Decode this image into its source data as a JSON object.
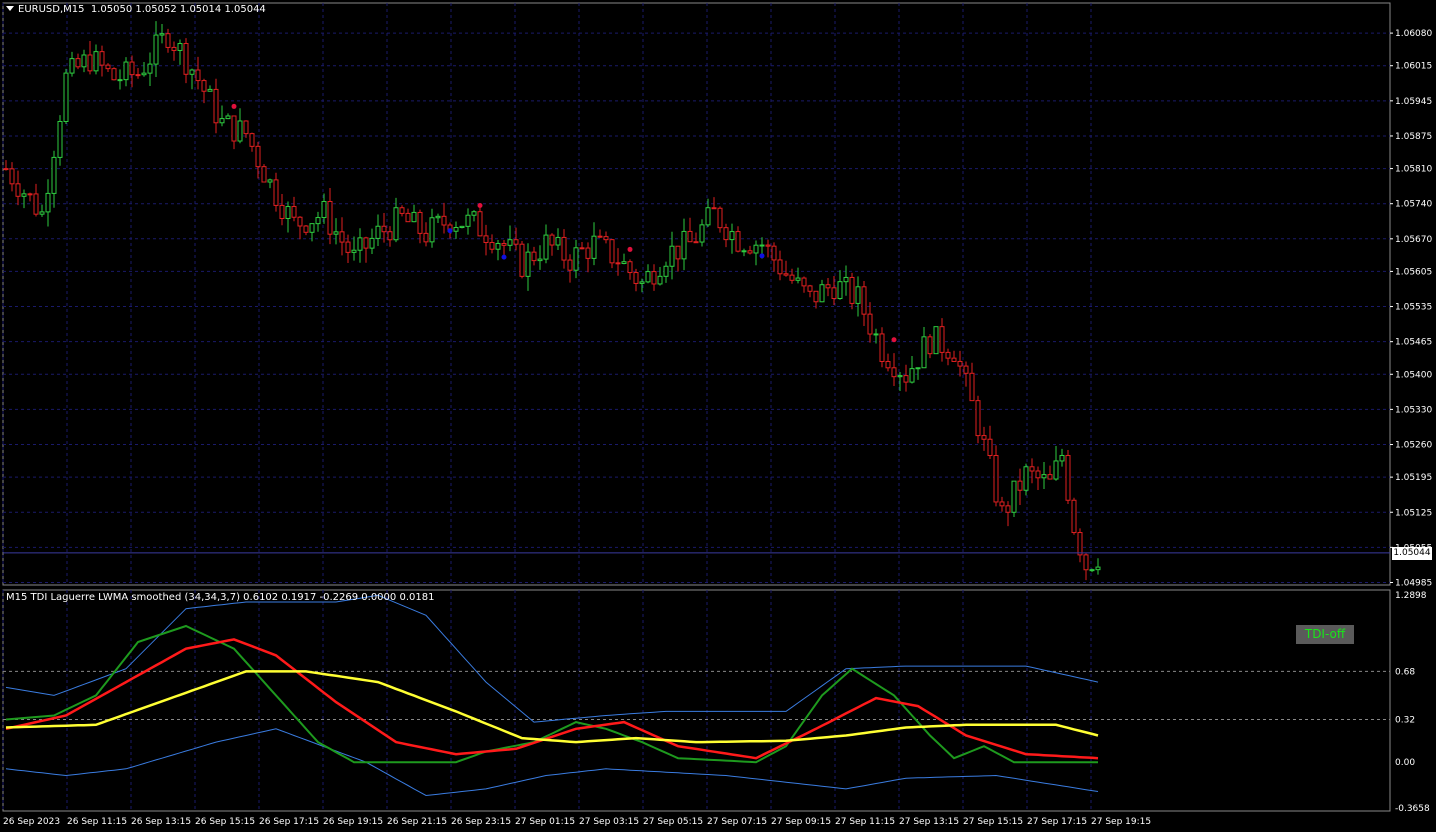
{
  "header": {
    "symbol_label": "EURUSD,M15",
    "ohlc_text": "1.05050 1.05052 1.05014 1.05044"
  },
  "indicator": {
    "title": "M15 TDI Laguerre LWMA smoothed (34,34,3,7) 0.6102 0.1917 -0.2269 0.0000 0.0181",
    "button_label": "TDI-off",
    "levels": [
      0.68,
      0.32
    ],
    "y_range": [
      -0.3658,
      1.2898
    ],
    "y_ticks": [
      "1.2898",
      "0.68",
      "0.32",
      "0.00",
      "-0.3658"
    ]
  },
  "colors": {
    "background": "#000000",
    "grid": "#1a1a6a",
    "bull": "#2ecc40",
    "bear": "#e02020",
    "upper_band": "#3a7ce0",
    "tdi_green": "#1e9a1e",
    "tdi_red": "#ff1a1a",
    "tdi_yellow": "#ffff33",
    "arrow_up": "#e0103c",
    "arrow_down": "#1010e0"
  },
  "chart_data": [
    {
      "type": "candlestick",
      "title": "EURUSD,M15",
      "y_range": [
        1.0498,
        1.0614
      ],
      "y_ticks": [
        "1.06080",
        "1.06015",
        "1.05945",
        "1.05875",
        "1.05810",
        "1.05740",
        "1.05670",
        "1.05605",
        "1.05535",
        "1.05465",
        "1.05400",
        "1.05330",
        "1.05260",
        "1.05195",
        "1.05125",
        "1.05055",
        "1.04985"
      ],
      "current_price": "1.05044",
      "x_ticks": [
        "26 Sep 2023",
        "26 Sep 11:15",
        "26 Sep 13:15",
        "26 Sep 15:15",
        "26 Sep 17:15",
        "26 Sep 19:15",
        "26 Sep 21:15",
        "26 Sep 23:15",
        "27 Sep 01:15",
        "27 Sep 03:15",
        "27 Sep 05:15",
        "27 Sep 07:15",
        "27 Sep 09:15",
        "27 Sep 11:15",
        "27 Sep 13:15",
        "27 Sep 15:15",
        "27 Sep 17:15",
        "27 Sep 19:15"
      ],
      "close_anchors": [
        [
          0,
          1.0581
        ],
        [
          6,
          1.0572
        ],
        [
          10,
          1.0599
        ],
        [
          14,
          1.0603
        ],
        [
          18,
          1.0599
        ],
        [
          22,
          1.06
        ],
        [
          27,
          1.0608
        ],
        [
          31,
          1.0601
        ],
        [
          36,
          1.059
        ],
        [
          40,
          1.0588
        ],
        [
          44,
          1.0578
        ],
        [
          48,
          1.057
        ],
        [
          53,
          1.0572
        ],
        [
          58,
          1.0563
        ],
        [
          62,
          1.0568
        ],
        [
          66,
          1.0571
        ],
        [
          70,
          1.0568
        ],
        [
          74,
          1.0571
        ],
        [
          78,
          1.057
        ],
        [
          82,
          1.0567
        ],
        [
          86,
          1.0562
        ],
        [
          90,
          1.0566
        ],
        [
          94,
          1.0563
        ],
        [
          98,
          1.0566
        ],
        [
          102,
          1.0563
        ],
        [
          106,
          1.0558
        ],
        [
          110,
          1.0564
        ],
        [
          114,
          1.0566
        ],
        [
          118,
          1.0572
        ],
        [
          122,
          1.0567
        ],
        [
          126,
          1.0566
        ],
        [
          130,
          1.056
        ],
        [
          134,
          1.0555
        ],
        [
          138,
          1.0558
        ],
        [
          142,
          1.0555
        ],
        [
          146,
          1.0545
        ],
        [
          150,
          1.054
        ],
        [
          154,
          1.0547
        ],
        [
          158,
          1.0545
        ],
        [
          162,
          1.053
        ],
        [
          166,
          1.0512
        ],
        [
          170,
          1.052
        ],
        [
          174,
          1.0518
        ],
        [
          176,
          1.0524
        ],
        [
          178,
          1.051
        ],
        [
          180,
          1.0502
        ],
        [
          182,
          1.0504
        ]
      ],
      "markers_up": [
        38,
        79,
        104,
        148
      ],
      "markers_down": [
        74,
        83,
        126
      ]
    },
    {
      "type": "line",
      "title": "M15 TDI Laguerre LWMA smoothed (34,34,3,7)",
      "series": [
        {
          "color": "blue",
          "values": [
            [
              0,
              0.56
            ],
            [
              8,
              0.5
            ],
            [
              20,
              0.7
            ],
            [
              30,
              1.15
            ],
            [
              40,
              1.2
            ],
            [
              55,
              1.2
            ],
            [
              62,
              1.25
            ],
            [
              70,
              1.1
            ],
            [
              80,
              0.6
            ],
            [
              88,
              0.3
            ],
            [
              100,
              0.35
            ],
            [
              110,
              0.38
            ],
            [
              130,
              0.38
            ],
            [
              140,
              0.7
            ],
            [
              150,
              0.72
            ],
            [
              170,
              0.72
            ],
            [
              182,
              0.6
            ]
          ]
        },
        {
          "color": "blue",
          "values": [
            [
              0,
              -0.05
            ],
            [
              10,
              -0.1
            ],
            [
              20,
              -0.05
            ],
            [
              35,
              0.15
            ],
            [
              45,
              0.25
            ],
            [
              60,
              0.0
            ],
            [
              70,
              -0.25
            ],
            [
              80,
              -0.2
            ],
            [
              90,
              -0.1
            ],
            [
              100,
              -0.05
            ],
            [
              120,
              -0.1
            ],
            [
              140,
              -0.2
            ],
            [
              150,
              -0.12
            ],
            [
              165,
              -0.1
            ],
            [
              182,
              -0.22
            ]
          ]
        },
        {
          "color": "green",
          "values": [
            [
              0,
              0.32
            ],
            [
              8,
              0.35
            ],
            [
              15,
              0.5
            ],
            [
              22,
              0.9
            ],
            [
              30,
              1.02
            ],
            [
              38,
              0.85
            ],
            [
              45,
              0.5
            ],
            [
              52,
              0.15
            ],
            [
              58,
              0.0
            ],
            [
              75,
              0.0
            ],
            [
              80,
              0.08
            ],
            [
              88,
              0.15
            ],
            [
              95,
              0.3
            ],
            [
              100,
              0.25
            ],
            [
              106,
              0.15
            ],
            [
              112,
              0.03
            ],
            [
              125,
              0.0
            ],
            [
              130,
              0.12
            ],
            [
              136,
              0.5
            ],
            [
              141,
              0.7
            ],
            [
              148,
              0.5
            ],
            [
              154,
              0.2
            ],
            [
              158,
              0.03
            ],
            [
              163,
              0.12
            ],
            [
              168,
              0.0
            ],
            [
              182,
              0.0
            ]
          ]
        },
        {
          "color": "red",
          "values": [
            [
              0,
              0.25
            ],
            [
              10,
              0.35
            ],
            [
              20,
              0.6
            ],
            [
              30,
              0.85
            ],
            [
              38,
              0.92
            ],
            [
              45,
              0.8
            ],
            [
              55,
              0.45
            ],
            [
              65,
              0.15
            ],
            [
              75,
              0.06
            ],
            [
              85,
              0.1
            ],
            [
              95,
              0.25
            ],
            [
              103,
              0.3
            ],
            [
              112,
              0.12
            ],
            [
              125,
              0.03
            ],
            [
              135,
              0.25
            ],
            [
              145,
              0.48
            ],
            [
              152,
              0.42
            ],
            [
              160,
              0.2
            ],
            [
              170,
              0.06
            ],
            [
              182,
              0.03
            ]
          ]
        },
        {
          "color": "yellow",
          "values": [
            [
              0,
              0.26
            ],
            [
              15,
              0.28
            ],
            [
              30,
              0.52
            ],
            [
              40,
              0.68
            ],
            [
              50,
              0.68
            ],
            [
              62,
              0.6
            ],
            [
              75,
              0.38
            ],
            [
              86,
              0.18
            ],
            [
              95,
              0.15
            ],
            [
              105,
              0.18
            ],
            [
              115,
              0.15
            ],
            [
              130,
              0.16
            ],
            [
              140,
              0.2
            ],
            [
              150,
              0.26
            ],
            [
              160,
              0.28
            ],
            [
              175,
              0.28
            ],
            [
              182,
              0.2
            ]
          ]
        }
      ]
    }
  ]
}
